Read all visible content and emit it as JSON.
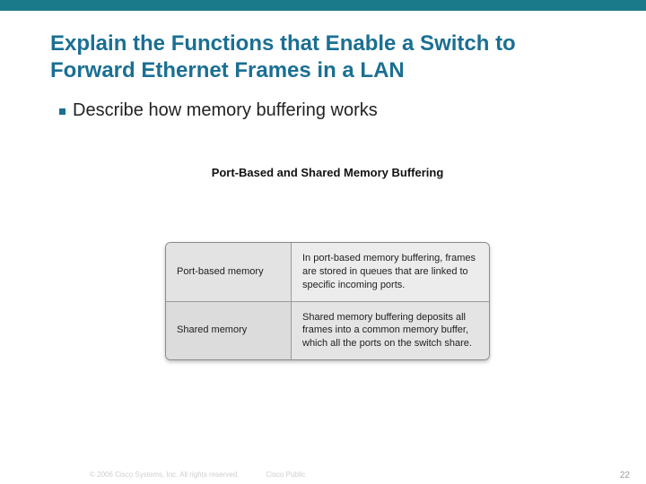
{
  "title": "Explain the Functions that Enable a Switch to Forward Ethernet Frames in a LAN",
  "bullet": "Describe how memory buffering works",
  "figure": {
    "title": "Port-Based and Shared Memory Buffering",
    "rows": [
      {
        "label": "Port-based memory",
        "desc": "In port-based memory buffering, frames are stored in queues that are linked to specific incoming ports."
      },
      {
        "label": "Shared memory",
        "desc": "Shared memory buffering deposits all frames into a common memory buffer, which all the ports on the switch share."
      }
    ]
  },
  "footer": {
    "copyright": "© 2006 Cisco Systems, Inc. All rights reserved.",
    "label": "Cisco Public"
  },
  "page_number": "22"
}
